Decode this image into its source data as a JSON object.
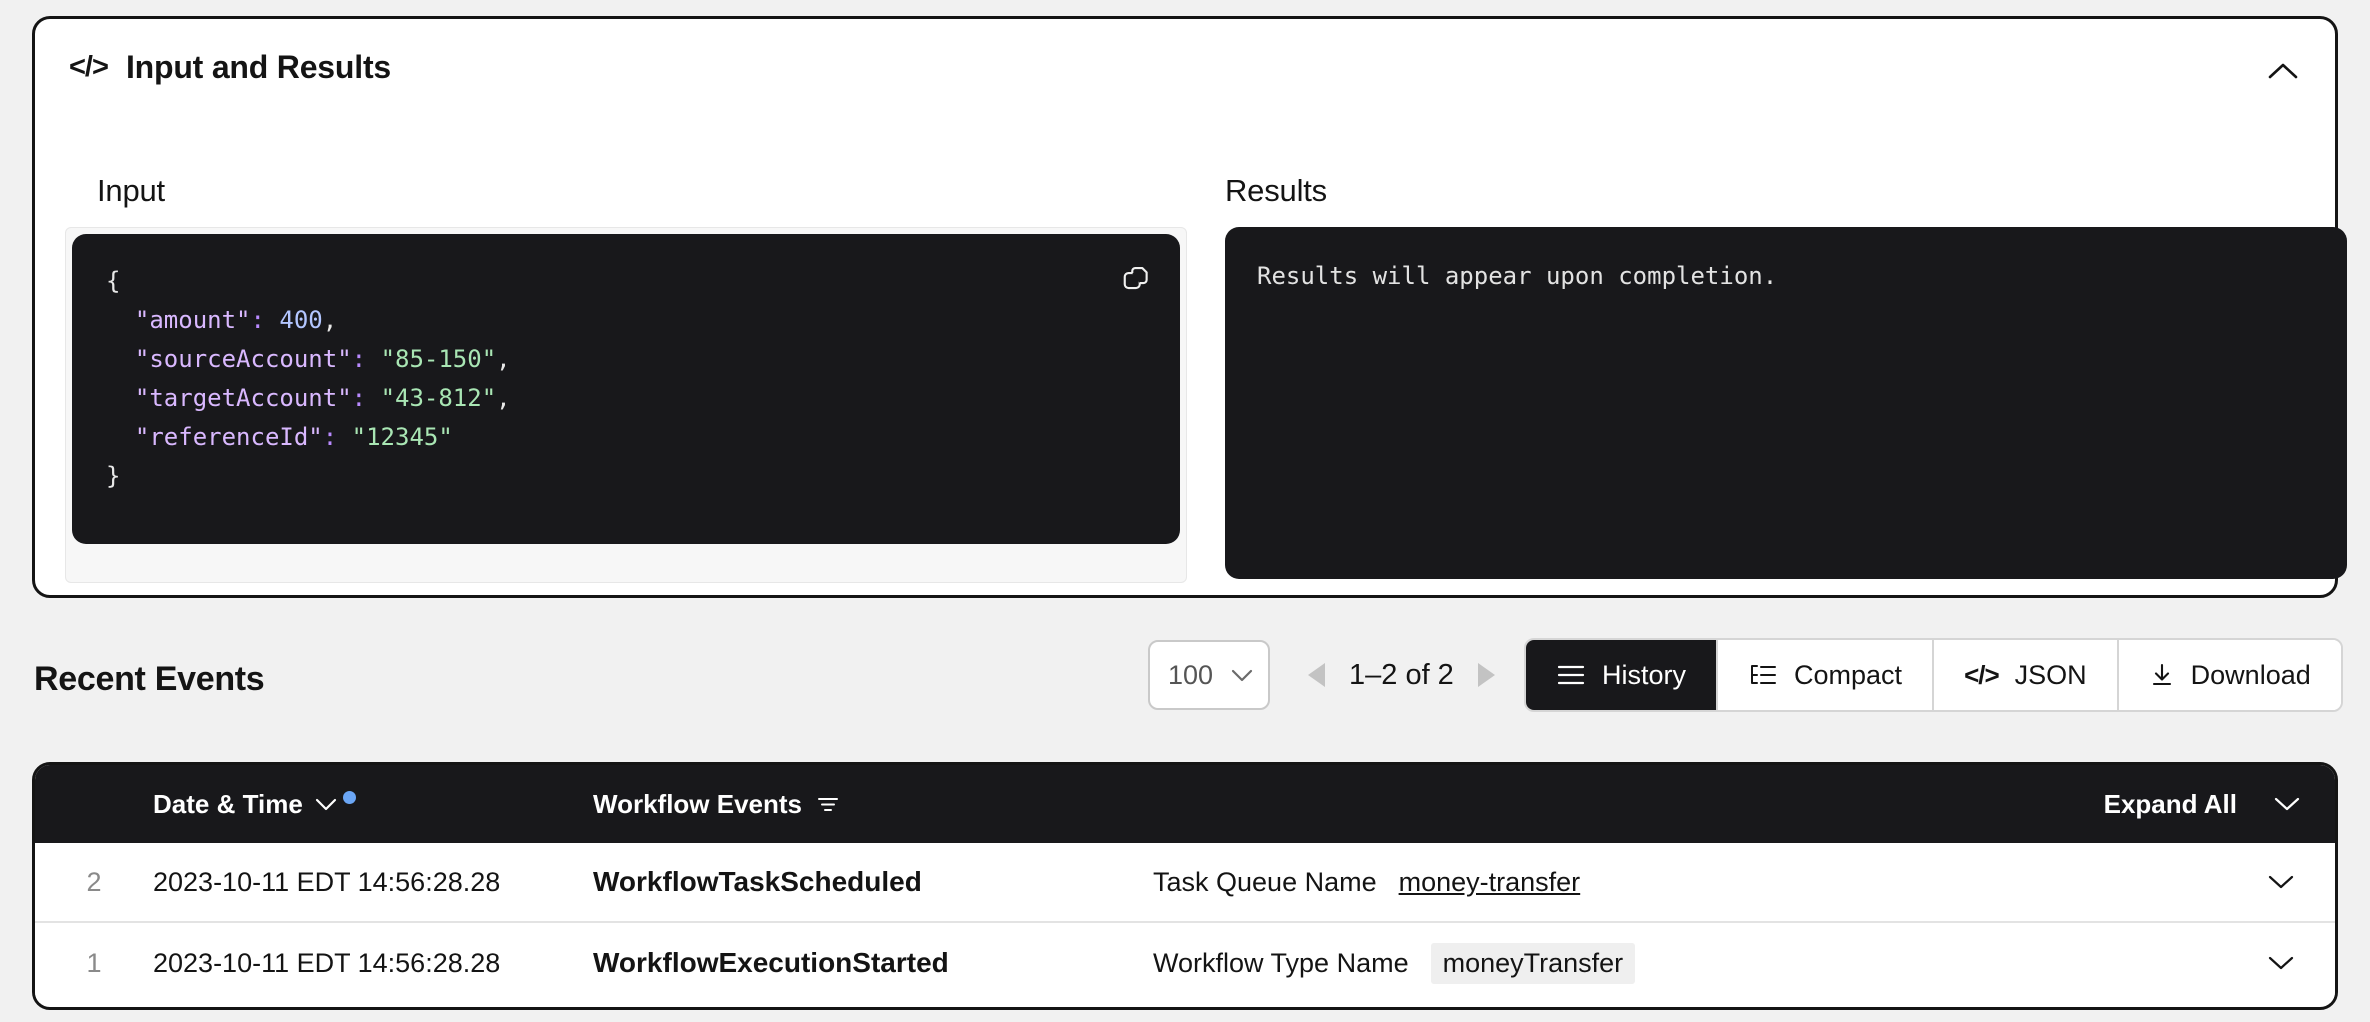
{
  "io_card": {
    "title": "Input and Results",
    "code_glyph": "</>",
    "collapse_icon": "chevron-up-icon",
    "input": {
      "label": "Input",
      "copy_icon": "copy-icon",
      "json": {
        "open_brace": "{",
        "close_brace": "}",
        "entries": [
          {
            "key": "\"amount\"",
            "value": "400",
            "type": "number",
            "comma": ","
          },
          {
            "key": "\"sourceAccount\"",
            "value": "\"85-150\"",
            "type": "string",
            "comma": ","
          },
          {
            "key": "\"targetAccount\"",
            "value": "\"43-812\"",
            "type": "string",
            "comma": ","
          },
          {
            "key": "\"referenceId\"",
            "value": "\"12345\"",
            "type": "string",
            "comma": ""
          }
        ]
      }
    },
    "results": {
      "label": "Results",
      "placeholder": "Results will appear upon completion."
    }
  },
  "events_section": {
    "title": "Recent Events",
    "pager": {
      "page_size": "100",
      "range_label": "1–2 of 2",
      "prev_icon": "triangle-left-icon",
      "next_icon": "triangle-right-icon"
    },
    "view_buttons": [
      {
        "label": "History",
        "icon": "hamburger-icon",
        "active": true
      },
      {
        "label": "Compact",
        "icon": "tree-list-icon",
        "active": false
      },
      {
        "label": "JSON",
        "icon": "code-icon",
        "active": false
      },
      {
        "label": "Download",
        "icon": "download-icon",
        "active": false
      }
    ],
    "table": {
      "columns": {
        "date": "Date & Time",
        "events": "Workflow Events",
        "sort_icon": "chevron-down-icon",
        "filter_icon": "filter-icon"
      },
      "expand_all": "Expand All",
      "expand_all_icon": "chevron-down-icon",
      "rows": [
        {
          "index": "2",
          "datetime": "2023-10-11 EDT 14:56:28.28",
          "event": "WorkflowTaskScheduled",
          "attr_key": "Task Queue Name",
          "attr_value": "money-transfer",
          "attr_style": "link"
        },
        {
          "index": "1",
          "datetime": "2023-10-11 EDT 14:56:28.28",
          "event": "WorkflowExecutionStarted",
          "attr_key": "Workflow Type Name",
          "attr_value": "moneyTransfer",
          "attr_style": "chip"
        }
      ]
    }
  },
  "colors": {
    "ink": "#141414",
    "code_bg": "#18181b",
    "accent_dot": "#6ba6f5",
    "json_key": "#d9b8ff",
    "json_string": "#a9e6b4",
    "json_number": "#b3c6ff"
  }
}
